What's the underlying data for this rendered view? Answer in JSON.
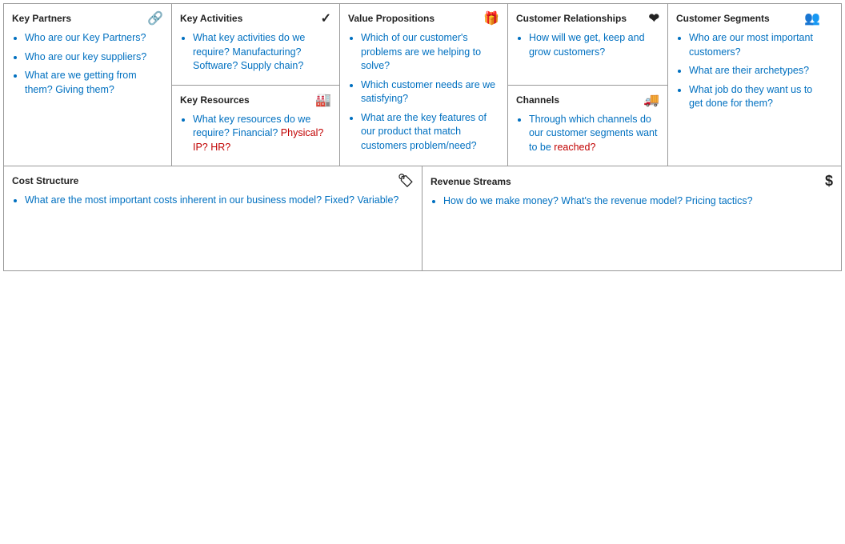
{
  "cells": {
    "keyPartners": {
      "title": "Key Partners",
      "icon": "🔗",
      "items": [
        {
          "text": "Who are our Key Partners?",
          "color": "blue"
        },
        {
          "text": "Who are our key suppliers?",
          "color": "blue"
        },
        {
          "text": "What are we getting from them? Giving them?",
          "color": "blue"
        }
      ]
    },
    "keyActivities": {
      "title": "Key Activities",
      "icon": "✔",
      "items": [
        {
          "text": "What key activities do we require? Manufacturing? Software? Supply chain?",
          "color": "blue"
        }
      ]
    },
    "keyResources": {
      "title": "Key Resources",
      "icon": "🏭",
      "items": [
        {
          "parts": [
            {
              "text": "What key resources do we require? Financial? ",
              "color": "blue"
            },
            {
              "text": "Physical? IP? HR?",
              "color": "red"
            }
          ]
        }
      ]
    },
    "valuePropositions": {
      "title": "Value Propositions",
      "icon": "🎁",
      "items": [
        {
          "text": "Which of our customer's problems are we helping to solve?",
          "color": "blue"
        },
        {
          "text": "Which customer needs are we satisfying?",
          "color": "blue"
        },
        {
          "text": "What are the key features of our product that match customers problem/need?",
          "color": "blue"
        }
      ]
    },
    "customerRelationships": {
      "title": "Customer Relationships",
      "icon": "♥",
      "items": [
        {
          "text": "How will we get, keep and grow customers?",
          "color": "blue"
        }
      ]
    },
    "channels": {
      "title": "Channels",
      "icon": "🚚",
      "items": [
        {
          "parts": [
            {
              "text": "Through which channels do our customer segments want to be ",
              "color": "blue"
            },
            {
              "text": "reached?",
              "color": "red"
            }
          ]
        }
      ]
    },
    "customerSegments": {
      "title": "Customer Segments",
      "icon": "👥",
      "items": [
        {
          "text": "Who are our most important customers?",
          "color": "blue"
        },
        {
          "text": "What are their archetypes?",
          "color": "blue"
        },
        {
          "text": "What job do they want us to get done for them?",
          "color": "blue"
        }
      ]
    },
    "costStructure": {
      "title": "Cost Structure",
      "icon": "🏷",
      "items": [
        {
          "parts": [
            {
              "text": "What are the most important costs inherent in our business model? Fixed? Variable?",
              "color": "blue"
            }
          ]
        }
      ]
    },
    "revenueStreams": {
      "title": "Revenue Streams",
      "icon": "$",
      "items": [
        {
          "text": "How do we make money? What's the revenue model? Pricing tactics?",
          "color": "blue"
        }
      ]
    }
  }
}
